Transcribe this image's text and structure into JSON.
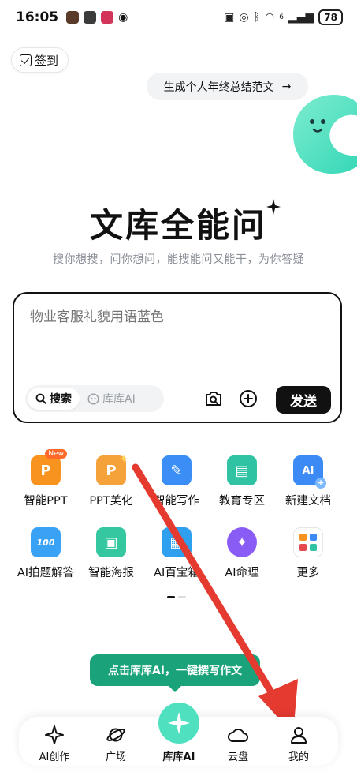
{
  "status_bar": {
    "time": "16:05",
    "battery": "78",
    "network": "6"
  },
  "checkin": {
    "label": "签到"
  },
  "suggestion": {
    "text": "生成个人年终总结范文",
    "arrow": "→"
  },
  "hero": {
    "title": "文库全能问",
    "subtitle": "搜你想搜，问你想问，能搜能问又能干，为你答疑"
  },
  "input": {
    "placeholder": "物业客服礼貌用语蓝色",
    "modes": [
      {
        "label": "搜索",
        "active": true
      },
      {
        "label": "库库AI",
        "active": false
      }
    ],
    "send_label": "发送"
  },
  "tools": [
    {
      "label": "智能PPT",
      "icon": "ppt-icon",
      "glyph": "P",
      "color": "#f7931e",
      "badge": "New"
    },
    {
      "label": "PPT美化",
      "icon": "ppt-beautify-icon",
      "glyph": "P",
      "color": "#f6a23a"
    },
    {
      "label": "智能写作",
      "icon": "pen-icon",
      "glyph": "✎",
      "color": "#3a8ef6"
    },
    {
      "label": "教育专区",
      "icon": "book-icon",
      "glyph": "▤",
      "color": "#2fc2a3"
    },
    {
      "label": "新建文档",
      "icon": "new-doc-icon",
      "glyph": "AI",
      "color": "#3b8af5"
    },
    {
      "label": "AI拍题解答",
      "icon": "camera-solve-icon",
      "glyph": "100",
      "color": "#3aa2f5"
    },
    {
      "label": "智能海报",
      "icon": "poster-icon",
      "glyph": "▣",
      "color": "#35c7a0"
    },
    {
      "label": "AI百宝箱",
      "icon": "toolbox-icon",
      "glyph": "▦",
      "color": "#2f9ff0"
    },
    {
      "label": "AI命理",
      "icon": "star-orb-icon",
      "glyph": "✦",
      "color": "#8a5cf6"
    },
    {
      "label": "更多",
      "icon": "more-apps-icon",
      "glyph": "",
      "color": "#ffffff"
    }
  ],
  "tooltip": {
    "text": "点击库库AI，一键撰写作文"
  },
  "nav": {
    "items": [
      {
        "label": "AI创作",
        "icon": "sparkle-icon"
      },
      {
        "label": "广场",
        "icon": "planet-icon"
      },
      {
        "label": "库库AI",
        "icon": "kuku-ai-icon",
        "active": true
      },
      {
        "label": "云盘",
        "icon": "cloud-icon"
      },
      {
        "label": "我的",
        "icon": "user-icon"
      }
    ]
  },
  "colors": {
    "accent": "#1aa37a",
    "mascot": "#4fe0c0",
    "annotation_arrow": "#e53a2f"
  }
}
